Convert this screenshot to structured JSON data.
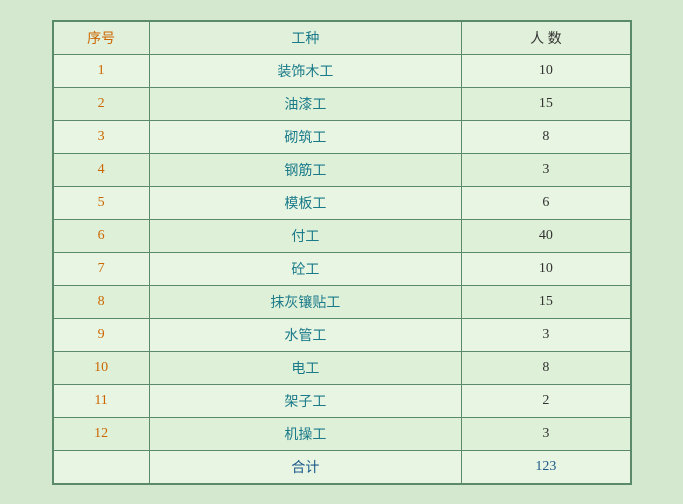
{
  "table": {
    "headers": {
      "index": "序号",
      "type": "工种",
      "count": "人    数"
    },
    "rows": [
      {
        "index": "1",
        "type": "装饰木工",
        "count": "10"
      },
      {
        "index": "2",
        "type": "油漆工",
        "count": "15"
      },
      {
        "index": "3",
        "type": "砌筑工",
        "count": "8"
      },
      {
        "index": "4",
        "type": "钢筋工",
        "count": "3"
      },
      {
        "index": "5",
        "type": "模板工",
        "count": "6"
      },
      {
        "index": "6",
        "type": "付工",
        "count": "40"
      },
      {
        "index": "7",
        "type": "砼工",
        "count": "10"
      },
      {
        "index": "8",
        "type": "抹灰镶贴工",
        "count": "15"
      },
      {
        "index": "9",
        "type": "水管工",
        "count": "3"
      },
      {
        "index": "10",
        "type": "电工",
        "count": "8"
      },
      {
        "index": "11",
        "type": "架子工",
        "count": "2"
      },
      {
        "index": "12",
        "type": "机操工",
        "count": "3"
      }
    ],
    "total": {
      "label": "合计",
      "count": "123"
    }
  }
}
